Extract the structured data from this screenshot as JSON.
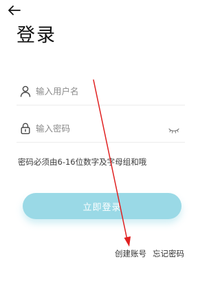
{
  "header": {
    "back_icon": "arrow-left-icon",
    "title": "登录"
  },
  "form": {
    "username": {
      "icon": "user-icon",
      "placeholder": "输入用户名",
      "value": ""
    },
    "password": {
      "icon": "lock-icon",
      "placeholder": "输入密码",
      "value": "",
      "toggle_icon": "eye-closed-icon"
    },
    "hint": "密码必须由6-16位数字及字母组和哦",
    "submit_label": "立即登录"
  },
  "links": {
    "create_account": "创建账号",
    "forgot_password": "忘记密码"
  },
  "colors": {
    "accent": "#9ad9e6",
    "annotation_arrow": "#e02020"
  }
}
